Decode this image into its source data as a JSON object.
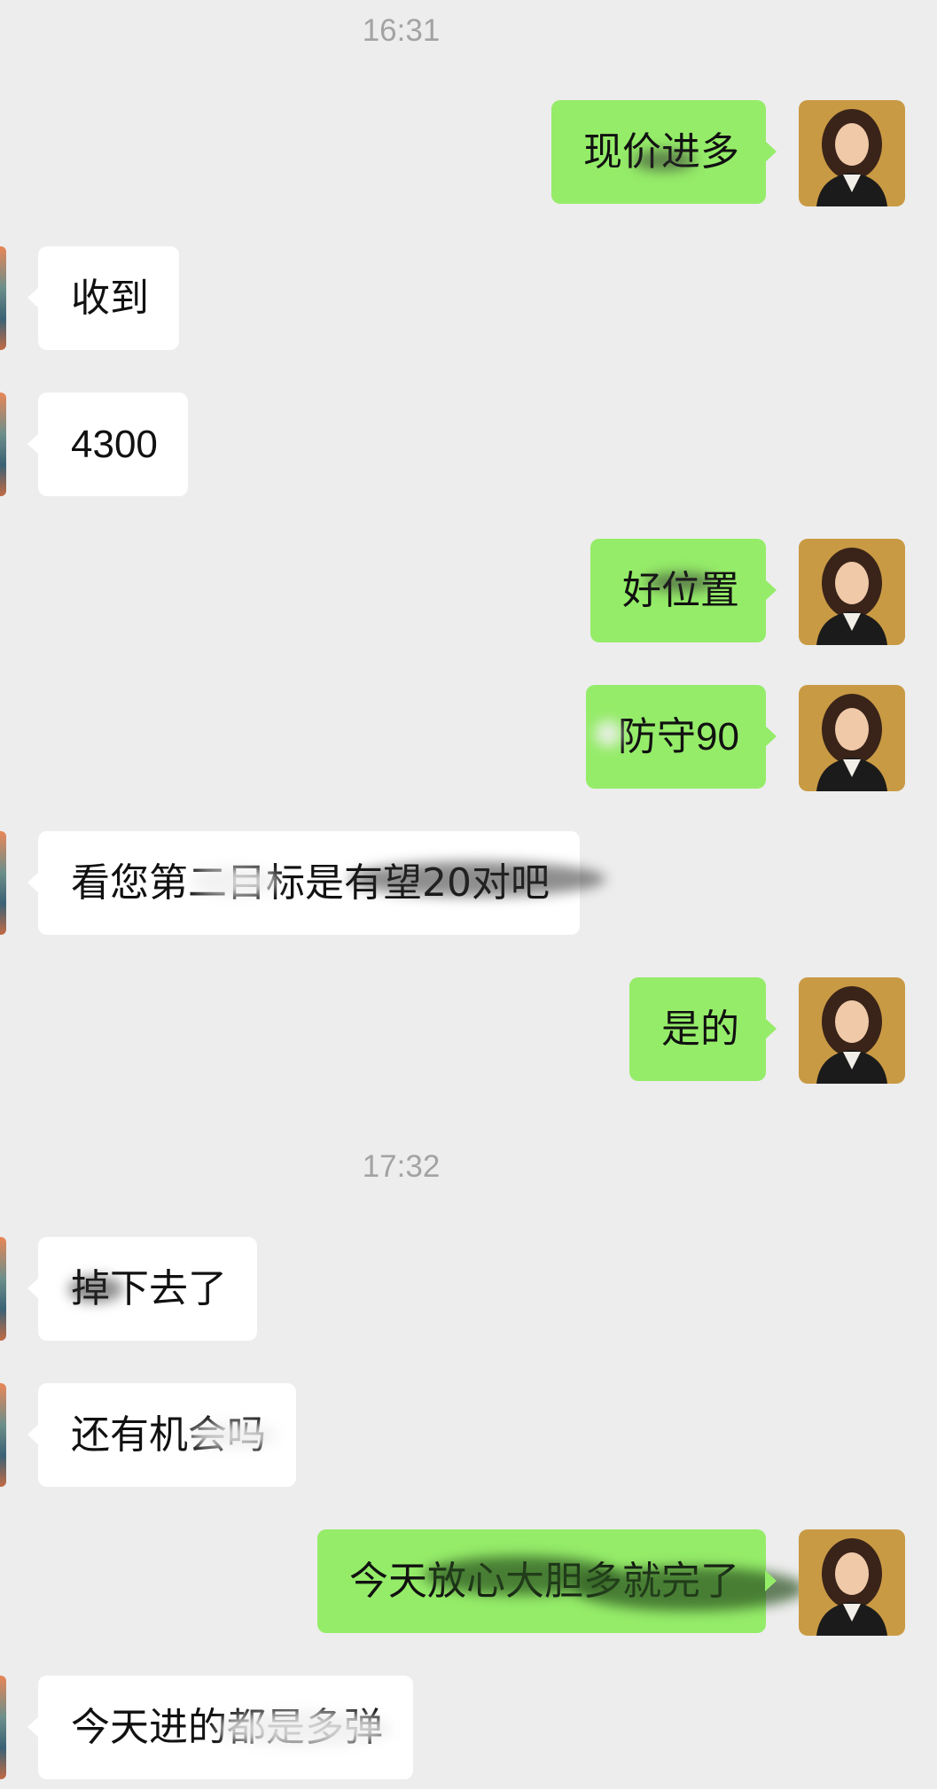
{
  "timestamps": [
    "16:31",
    "17:32"
  ],
  "messages": [
    {
      "dir": "out",
      "text": "现价进多"
    },
    {
      "dir": "in",
      "text": "收到"
    },
    {
      "dir": "in",
      "text": "4300"
    },
    {
      "dir": "out",
      "text": "好位置"
    },
    {
      "dir": "out",
      "text": "防守90"
    },
    {
      "dir": "in",
      "text": "看您第二目标是有望20对吧"
    },
    {
      "dir": "out",
      "text": "是的"
    },
    {
      "dir": "in",
      "text": "掉下去了"
    },
    {
      "dir": "in",
      "text": "还有机会吗"
    },
    {
      "dir": "out",
      "text": "今天放心大胆多就完了"
    },
    {
      "dir": "in",
      "text": "今天进的都是多弹"
    }
  ],
  "colors": {
    "outgoing_bubble": "#95ec69",
    "incoming_bubble": "#ffffff",
    "background": "#ededed"
  },
  "icons": {
    "my_avatar": "avatar-woman-portrait",
    "contact_avatar": "avatar-landscape"
  }
}
